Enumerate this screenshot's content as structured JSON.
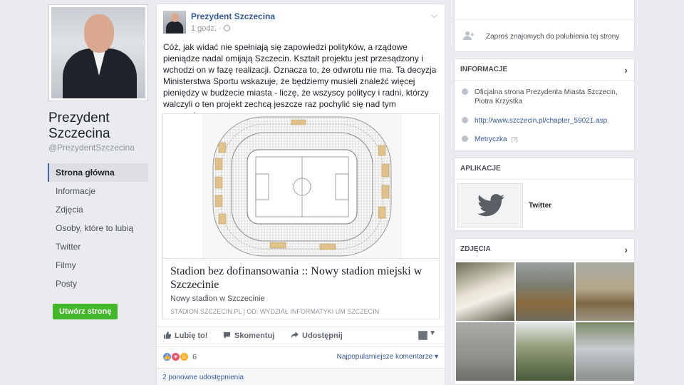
{
  "page": {
    "name": "Prezydent Szczecina",
    "handle": "@PrezydentSzczecina",
    "create_page_label": "Utwórz stronę"
  },
  "nav": {
    "items": [
      {
        "label": "Strona główna",
        "active": true
      },
      {
        "label": "Informacje"
      },
      {
        "label": "Zdjęcia"
      },
      {
        "label": "Osoby, które to lubią"
      },
      {
        "label": "Twitter"
      },
      {
        "label": "Filmy"
      },
      {
        "label": "Posty"
      }
    ]
  },
  "post": {
    "author": "Prezydent Szczecina",
    "time": "1 godz. ·",
    "text": "Cóż, jak widać nie spełniają się zapowiedzi polityków, a rządowe pieniądze nadal omijają Szczecin. Kształt projektu jest przesądzony i wchodzi on w fazę realizacji. Oznacza to, że odwrotu nie ma. Ta decyzja Ministerstwa Sportu wskazuje, że będziemy musieli znaleźć więcej pieniędzy w budżecie miasta - liczę, że wszyscy politycy i radni, którzy walczyli o ten projekt zechcą jeszcze raz pochylić się nad tym wyzwaniem.",
    "link": {
      "title": "Stadion bez dofinansowania :: Nowy stadion miejski w Szczecinie",
      "description": "Nowy stadion w Szczecinie",
      "source": "STADION.SZCZECIN.PL | OD: WYDZIAŁ INFORMATYKI UM SZCZECIN"
    },
    "actions": {
      "like": "Lubię to!",
      "comment": "Skomentuj",
      "share": "Udostępnij"
    },
    "reactions_count": "6",
    "sort_comments": "Najpopularniejsze komentarze ▾",
    "shares": "2 ponowne udostępnienia"
  },
  "sidebar": {
    "invite_text": "Zaproś znajomych do polubienia tej strony",
    "info": {
      "header": "INFORMACJE",
      "description": "Oficjalna strona Prezydenta Miasta Szczecin, Piotra Krzystka",
      "website": "http://www.szczecin.pl/chapter_59021.asp",
      "metryczka": "Metryczka",
      "metryczka_hint": "[?]"
    },
    "apps": {
      "header": "APLIKACJE",
      "app_name": "Twitter"
    },
    "photos": {
      "header": "ZDJĘCIA"
    }
  },
  "icons": {
    "chevron": "chevron-right-icon",
    "invite": "add-friend-icon",
    "twitter": "twitter-bird-icon"
  },
  "colors": {
    "link": "#365899",
    "accent": "#4267b2",
    "create_button": "#42b72a",
    "background": "#e9ebee"
  }
}
